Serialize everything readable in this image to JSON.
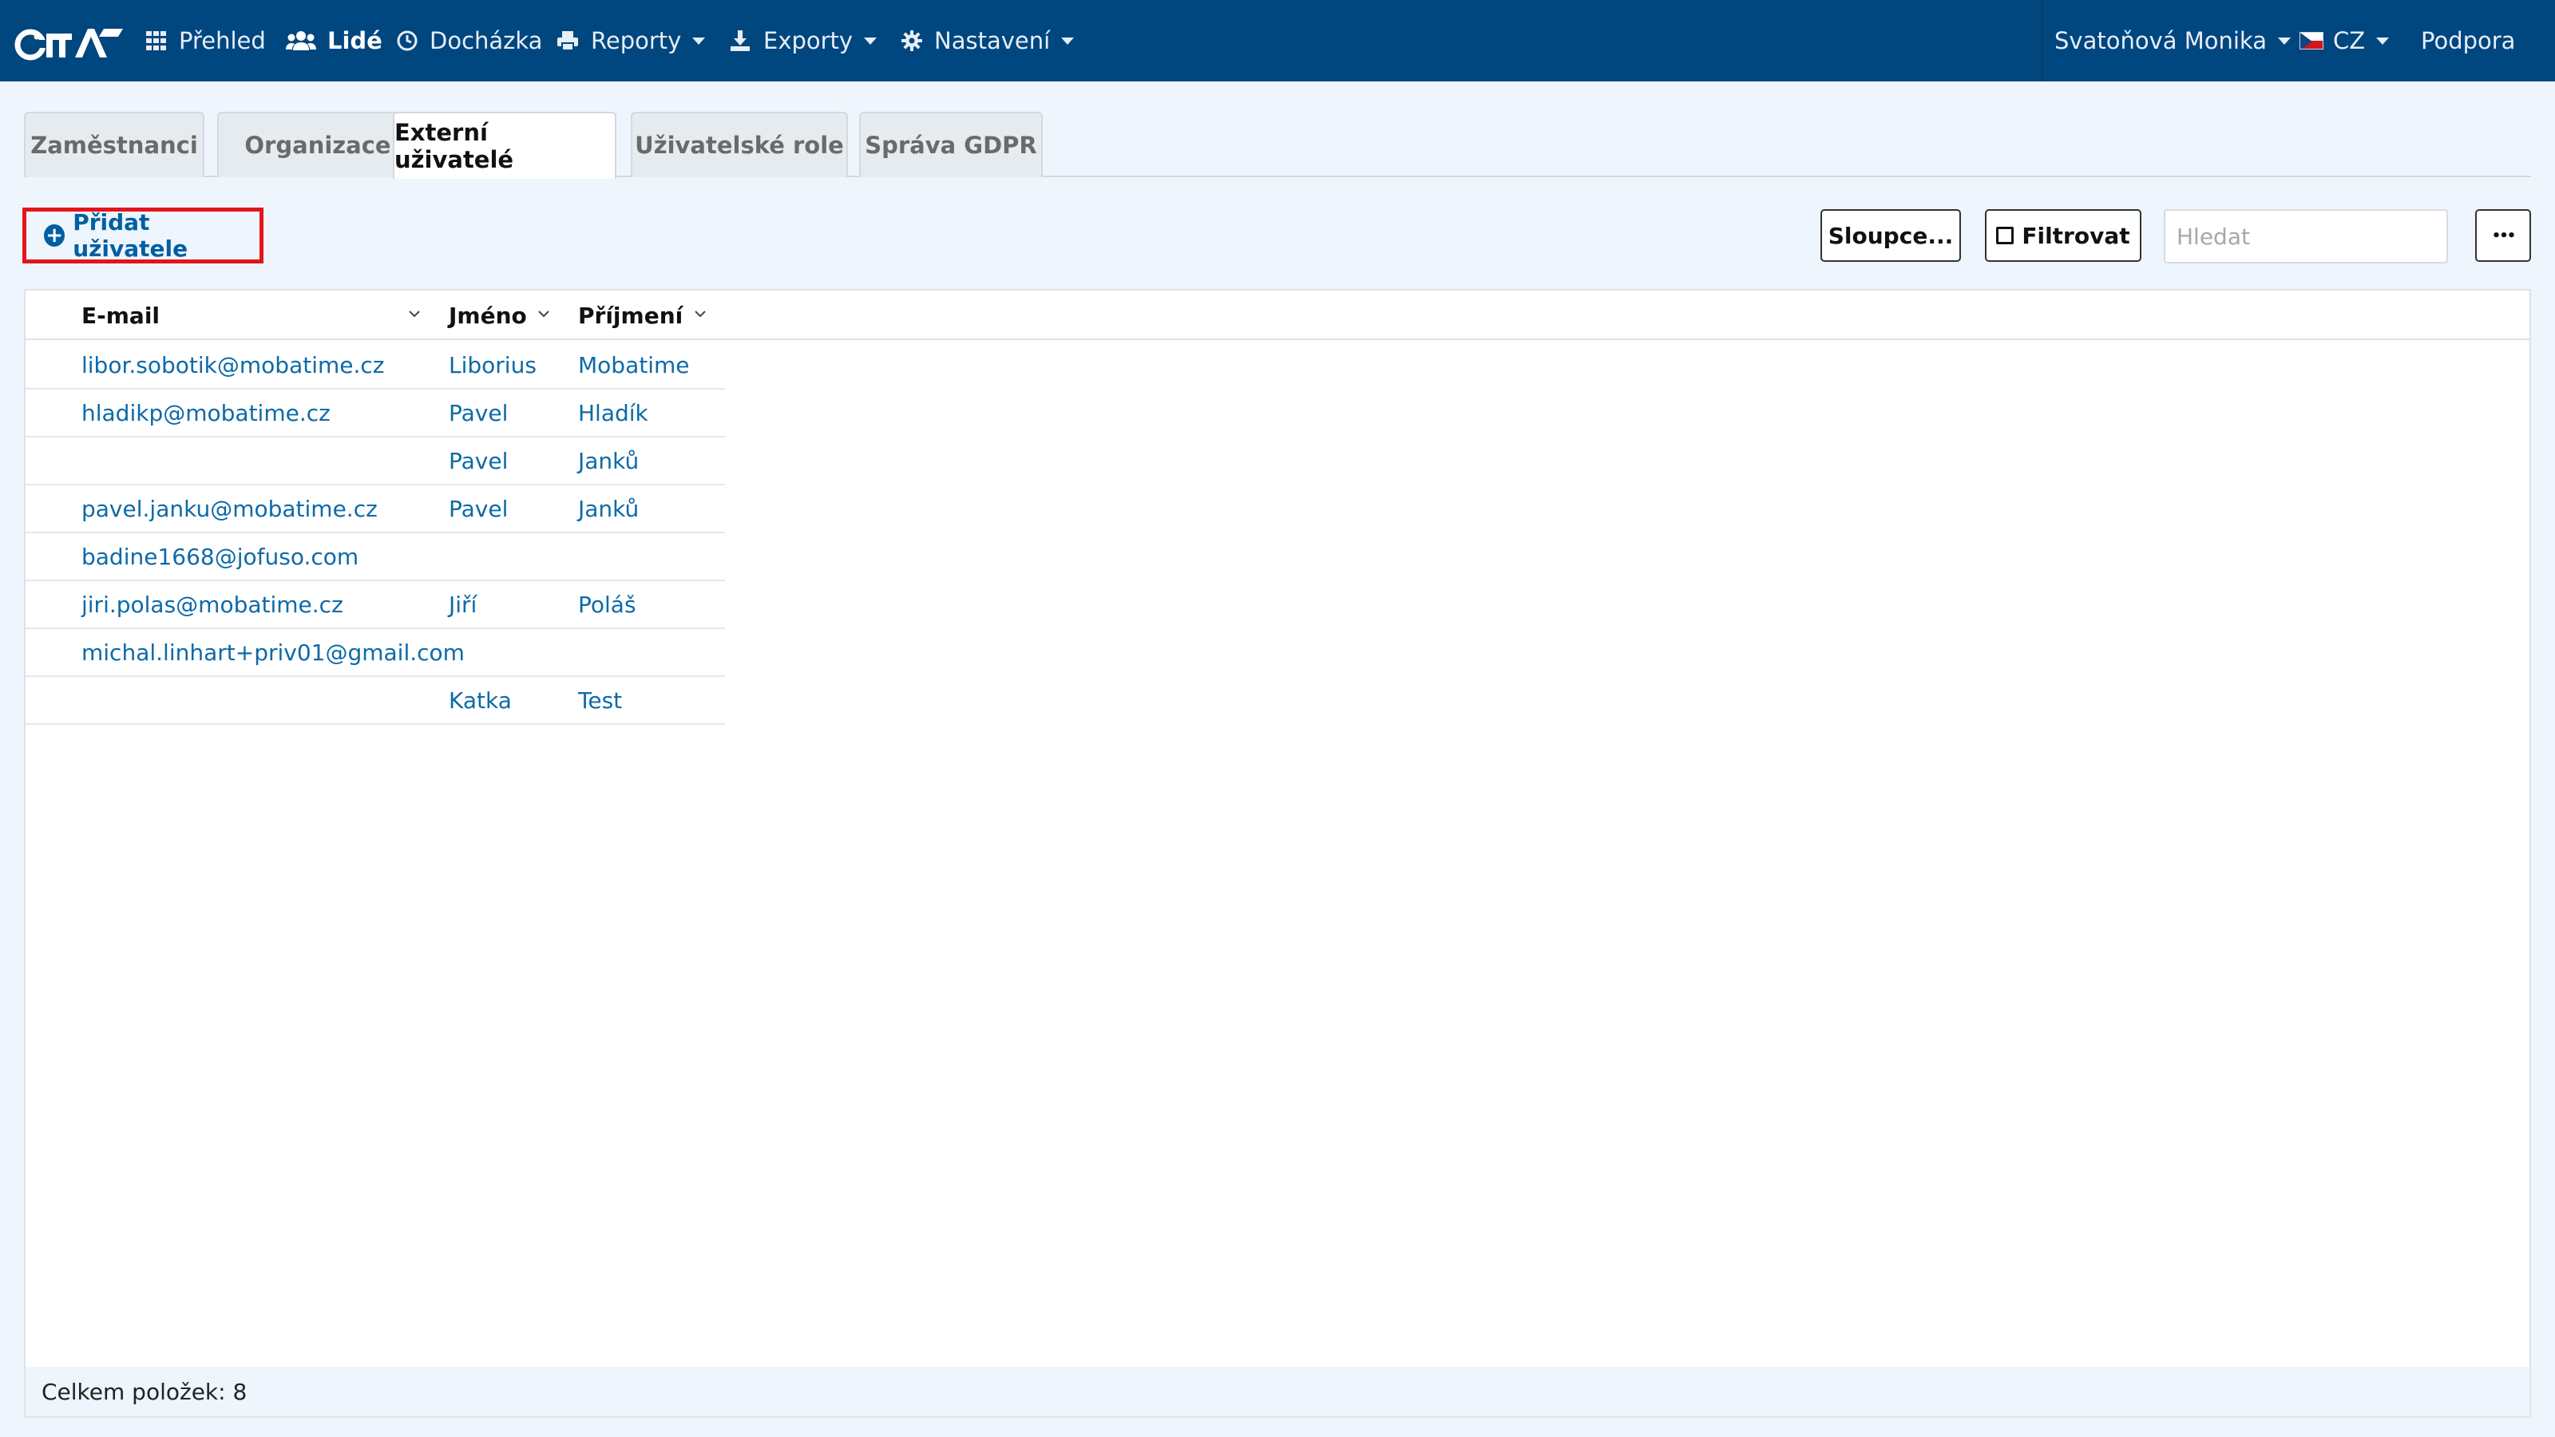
{
  "navbar": {
    "logo_text": "CiTA",
    "items": [
      {
        "label": "Přehled",
        "icon": "grid-icon",
        "active": false,
        "dropdown": false
      },
      {
        "label": "Lidé",
        "icon": "users-icon",
        "active": true,
        "dropdown": false
      },
      {
        "label": "Docházka",
        "icon": "clock-icon",
        "active": false,
        "dropdown": false
      },
      {
        "label": "Reporty",
        "icon": "printer-icon",
        "active": false,
        "dropdown": true
      },
      {
        "label": "Exporty",
        "icon": "download-icon",
        "active": false,
        "dropdown": true
      },
      {
        "label": "Nastavení",
        "icon": "gear-icon",
        "active": false,
        "dropdown": true
      }
    ],
    "user": "Svatoňová Monika",
    "language": "CZ",
    "support": "Podpora"
  },
  "tabs": [
    {
      "label": "Zaměstnanci",
      "active": false
    },
    {
      "label": "Organizace",
      "active": false
    },
    {
      "label": "Externí uživatelé",
      "active": true
    },
    {
      "label": "Uživatelské role",
      "active": false
    },
    {
      "label": "Správa GDPR",
      "active": false
    }
  ],
  "toolbar": {
    "add_user_label": "Přidat uživatele",
    "columns_label": "Sloupce...",
    "filter_label": "Filtrovat",
    "search_placeholder": "Hledat",
    "more_label": "•••"
  },
  "table": {
    "columns": [
      "E-mail",
      "Jméno",
      "Příjmení"
    ],
    "rows": [
      {
        "email": "libor.sobotik@mobatime.cz",
        "first_name": "Liborius",
        "last_name": "Mobatime"
      },
      {
        "email": "hladikp@mobatime.cz",
        "first_name": "Pavel",
        "last_name": "Hladík"
      },
      {
        "email": "",
        "first_name": "Pavel",
        "last_name": "Janků"
      },
      {
        "email": "pavel.janku@mobatime.cz",
        "first_name": "Pavel",
        "last_name": "Janků"
      },
      {
        "email": "badine1668@jofuso.com",
        "first_name": "",
        "last_name": ""
      },
      {
        "email": "jiri.polas@mobatime.cz",
        "first_name": "Jiří",
        "last_name": "Poláš"
      },
      {
        "email": "michal.linhart+priv01@gmail.com",
        "first_name": "",
        "last_name": ""
      },
      {
        "email": "",
        "first_name": "Katka",
        "last_name": "Test"
      }
    ],
    "footer": "Celkem položek: 8"
  },
  "colors": {
    "navbar": "#00467f",
    "link": "#0d6aa8",
    "highlight_border": "#e3141c",
    "background": "#eef5fc"
  }
}
